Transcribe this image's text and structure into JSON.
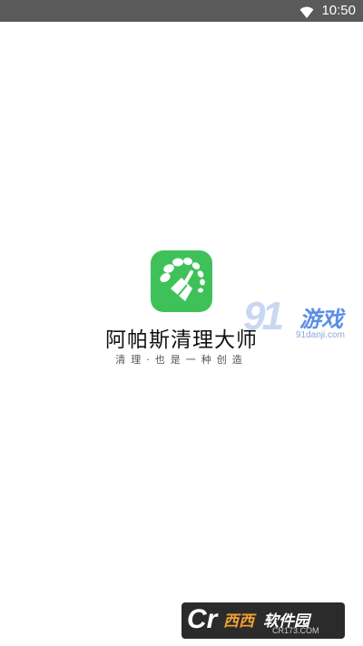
{
  "status_bar": {
    "time": "10:50",
    "wifi_icon": "wifi-icon"
  },
  "splash": {
    "app_icon": "broom-leaves-icon",
    "app_name": "阿帕斯清理大师",
    "tagline": "清理·也是一种创造",
    "accent_color": "#3fc15a"
  },
  "watermarks": {
    "site_91": {
      "logo": "91",
      "brand": "游戏",
      "domain": "91danji.com"
    },
    "site_cr": {
      "logo": "Cr",
      "title": "西西",
      "title2": "软件园",
      "domain": "CR173.COM"
    }
  }
}
